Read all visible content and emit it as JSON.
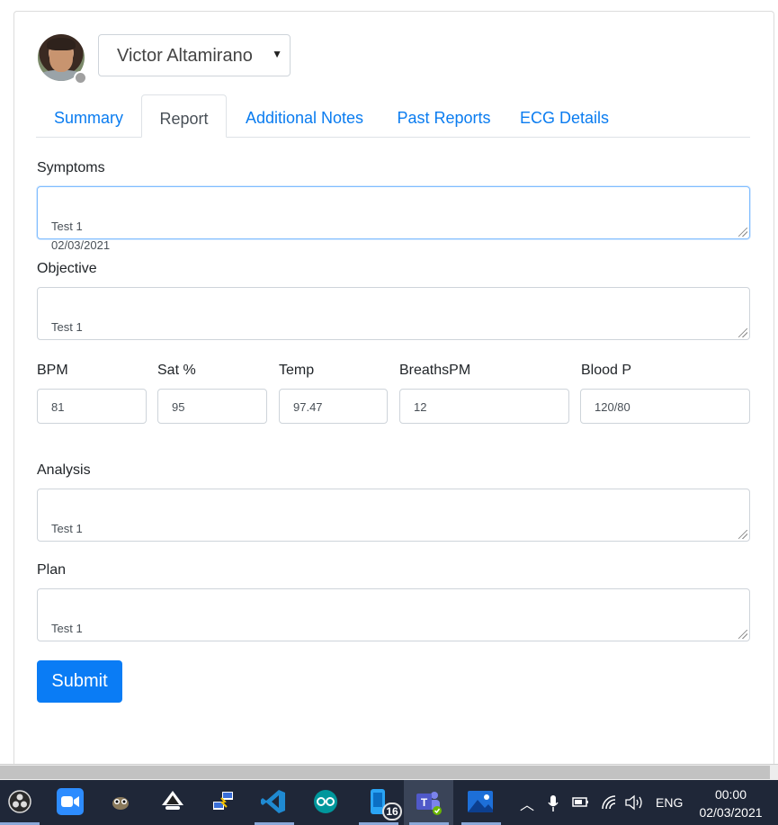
{
  "patient": {
    "name": "Victor Altamirano"
  },
  "tabs": [
    {
      "label": "Summary"
    },
    {
      "label": "Report"
    },
    {
      "label": "Additional Notes"
    },
    {
      "label": "Past Reports"
    },
    {
      "label": "ECG Details"
    }
  ],
  "active_tab": "Report",
  "form": {
    "symptoms": {
      "label": "Symptoms",
      "value": "Test 1\n02/03/2021"
    },
    "objective": {
      "label": "Objective",
      "value": "Test 1"
    },
    "vitals": {
      "bpm": {
        "label": "BPM",
        "value": "81"
      },
      "sat": {
        "label": "Sat %",
        "value": "95"
      },
      "temp": {
        "label": "Temp",
        "value": "97.47"
      },
      "breaths": {
        "label": "BreathsPM",
        "value": "12"
      },
      "blood_pressure": {
        "label": "Blood P",
        "value": "120/80"
      }
    },
    "analysis": {
      "label": "Analysis",
      "value": "Test 1"
    },
    "plan": {
      "label": "Plan",
      "value": "Test 1"
    },
    "submit_label": "Submit"
  },
  "taskbar": {
    "icons": [
      "obs-icon",
      "zoom-icon",
      "gimp-icon",
      "inkscape-icon",
      "network-tool-icon",
      "vscode-icon",
      "arduino-icon",
      "phone-app-icon",
      "teams-icon",
      "photos-icon"
    ],
    "badge_count": "16",
    "language": "ENG",
    "time": "00:00",
    "date": "02/03/2021"
  },
  "colors": {
    "accent": "#0a7cf5",
    "link": "#0a7cf0",
    "taskbar": "#1f2738"
  }
}
